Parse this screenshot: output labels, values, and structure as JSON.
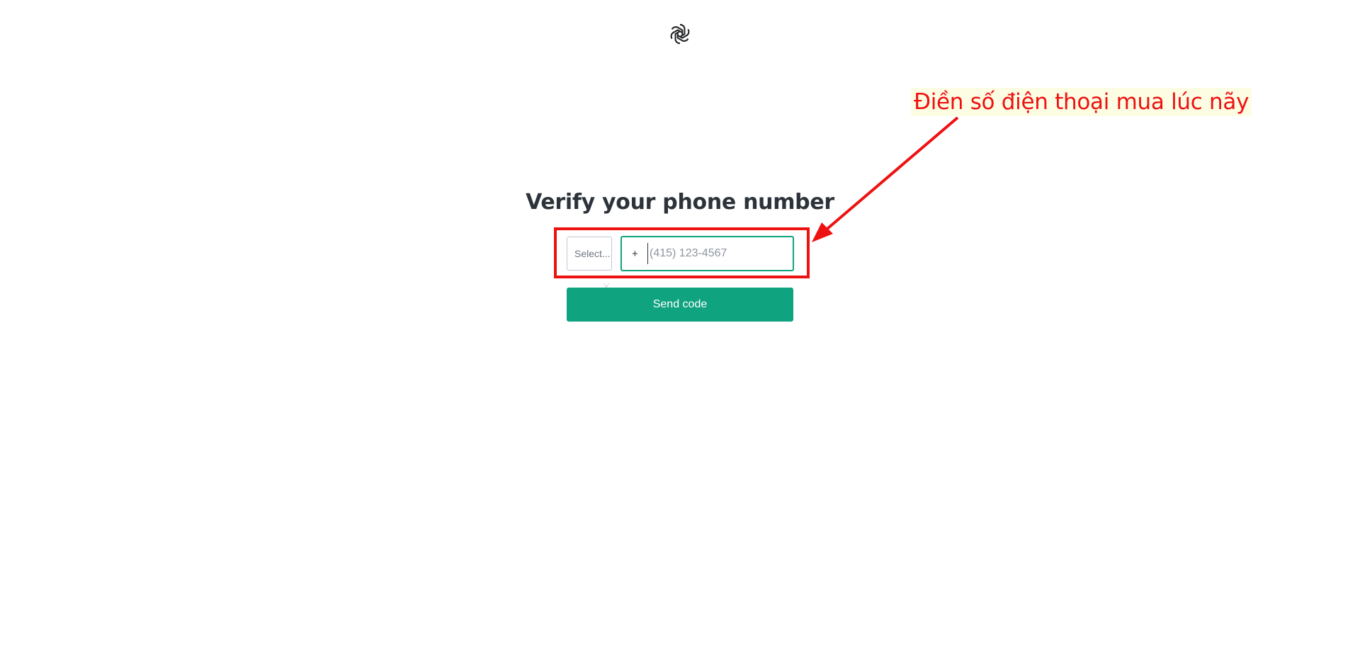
{
  "logo": {
    "icon": "openai-logo-icon"
  },
  "heading": "Verify your phone number",
  "country_select": {
    "placeholder": "Select..."
  },
  "phone": {
    "prefix": "+",
    "placeholder": "(415) 123-4567",
    "value": ""
  },
  "send_button": {
    "label": "Send code"
  },
  "annotation": {
    "text": "Điền số điện thoại mua lúc nãy",
    "color": "#ee1111"
  },
  "colors": {
    "accent": "#10a37f",
    "annotation_red": "#ee1111"
  }
}
